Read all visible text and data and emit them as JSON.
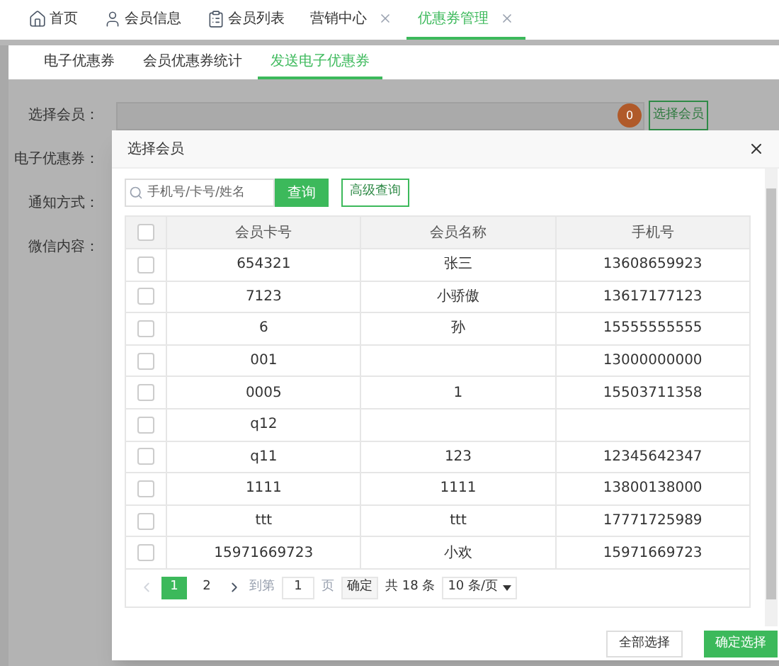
{
  "top_tabs": [
    {
      "label": "首页",
      "kind": "home",
      "closable": false,
      "selected": false
    },
    {
      "label": "会员信息",
      "kind": "user",
      "closable": false,
      "selected": false
    },
    {
      "label": "会员列表",
      "kind": "clipboard",
      "closable": false,
      "selected": false
    },
    {
      "label": "营销中心",
      "kind": "plain",
      "closable": true,
      "selected": false
    },
    {
      "label": "优惠券管理",
      "kind": "plain",
      "closable": true,
      "selected": true
    }
  ],
  "sub_tabs": [
    {
      "label": "电子优惠券",
      "selected": false
    },
    {
      "label": "会员优惠券统计",
      "selected": false
    },
    {
      "label": "发送电子优惠券",
      "selected": true
    }
  ],
  "form": {
    "labels": [
      "选择会员：",
      "电子优惠券：",
      "通知方式：",
      "微信内容："
    ],
    "member_count": "0",
    "select_button": "选择会员"
  },
  "modal": {
    "title": "选择会员",
    "search": {
      "placeholder": "手机号/卡号/姓名"
    },
    "query_button": "查询",
    "advanced_button": "高级查询",
    "table": {
      "header_checked": false,
      "columns": [
        "会员卡号",
        "会员名称",
        "手机号"
      ],
      "rows": [
        {
          "checked": false,
          "cells": [
            "654321",
            "张三",
            "13608659923"
          ]
        },
        {
          "checked": false,
          "cells": [
            "7123",
            "小骄傲",
            "13617177123"
          ]
        },
        {
          "checked": false,
          "cells": [
            "6",
            "孙",
            "15555555555"
          ]
        },
        {
          "checked": false,
          "cells": [
            "001",
            "",
            "13000000000"
          ]
        },
        {
          "checked": false,
          "cells": [
            "0005",
            "1",
            "15503711358"
          ]
        },
        {
          "checked": false,
          "cells": [
            "q12",
            "",
            ""
          ]
        },
        {
          "checked": false,
          "cells": [
            "q11",
            "123",
            "12345642347"
          ]
        },
        {
          "checked": false,
          "cells": [
            "1111",
            "1111",
            "13800138000"
          ]
        },
        {
          "checked": false,
          "cells": [
            "ttt",
            "ttt",
            "17771725989"
          ]
        },
        {
          "checked": false,
          "cells": [
            "15971669723",
            "小欢",
            "15971669723"
          ]
        }
      ]
    },
    "pagination": {
      "pages": [
        {
          "label": "1",
          "selected": true
        },
        {
          "label": "2",
          "selected": false
        }
      ],
      "goto_label": "到第",
      "goto_value": "1",
      "page_unit": "页",
      "confirm": "确定",
      "total": "共 18 条",
      "page_size": "10 条/页"
    },
    "buttons": [
      {
        "label": "全部选择",
        "kind": "secondary"
      },
      {
        "label": "确定选择",
        "kind": "primary"
      }
    ]
  }
}
